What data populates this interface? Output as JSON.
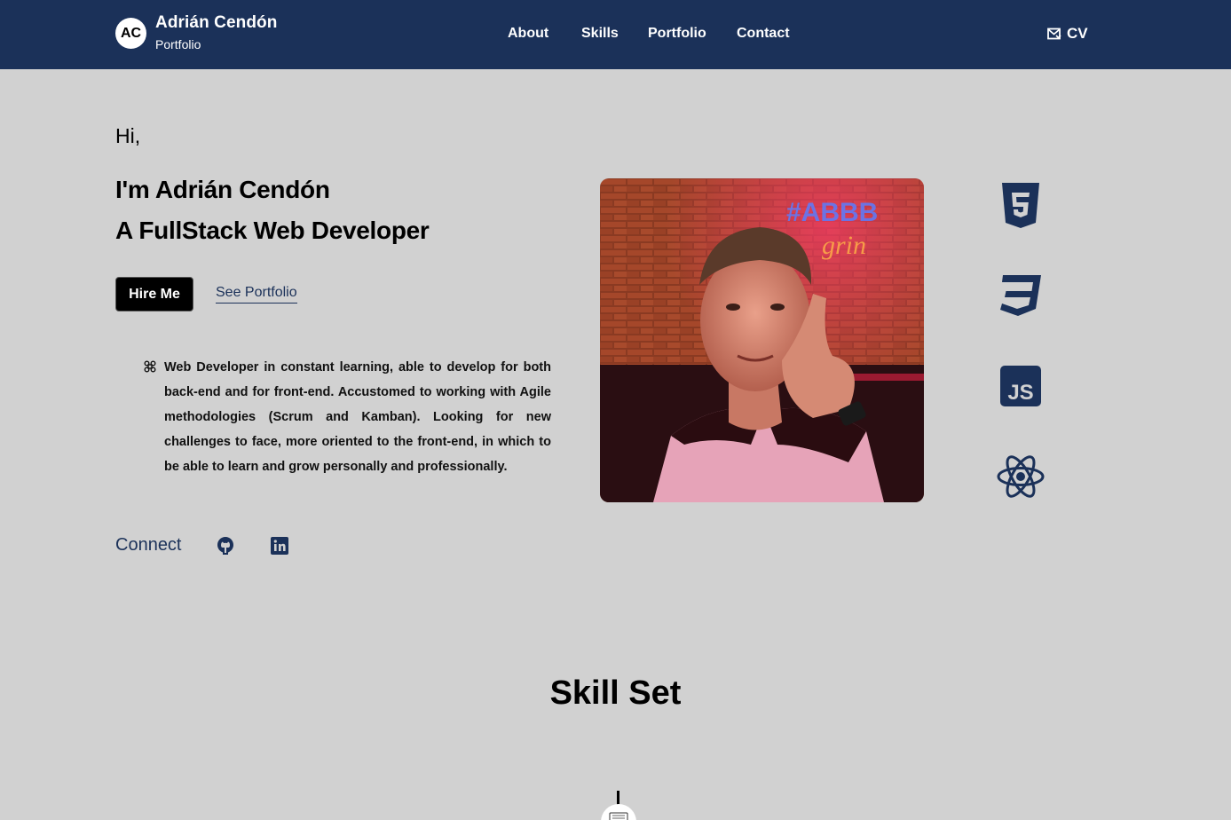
{
  "header": {
    "logo_initials": "AC",
    "brand_name": "Adrián Cendón",
    "brand_sub": "Portfolio",
    "nav": [
      "About",
      "Skills",
      "Portfolio",
      "Contact"
    ],
    "cv_label": "CV"
  },
  "hero": {
    "greeting": "Hi,",
    "line1": "I'm Adrián Cendón",
    "line2": "A FullStack Web Developer",
    "hire_label": "Hire Me",
    "portfolio_label": "See Portfolio",
    "bio": "Web Developer in constant learning, able to develop for both back-end and for front-end. Accustomed to working with Agile methodologies (Scrum and Kamban). Looking for new challenges to face, more oriented to the front-end, in which to be able to learn and grow personally and professionally.",
    "photo_icon": "profile-photo",
    "tech_icons": [
      "html5-icon",
      "css3-icon",
      "javascript-icon",
      "react-icon"
    ],
    "js_badge_text": "JS"
  },
  "connect": {
    "label": "Connect",
    "icons": [
      "github-icon",
      "linkedin-icon"
    ]
  },
  "skills": {
    "title": "Skill Set"
  },
  "colors": {
    "navy": "#1b3159",
    "background": "#d1d1d1"
  }
}
